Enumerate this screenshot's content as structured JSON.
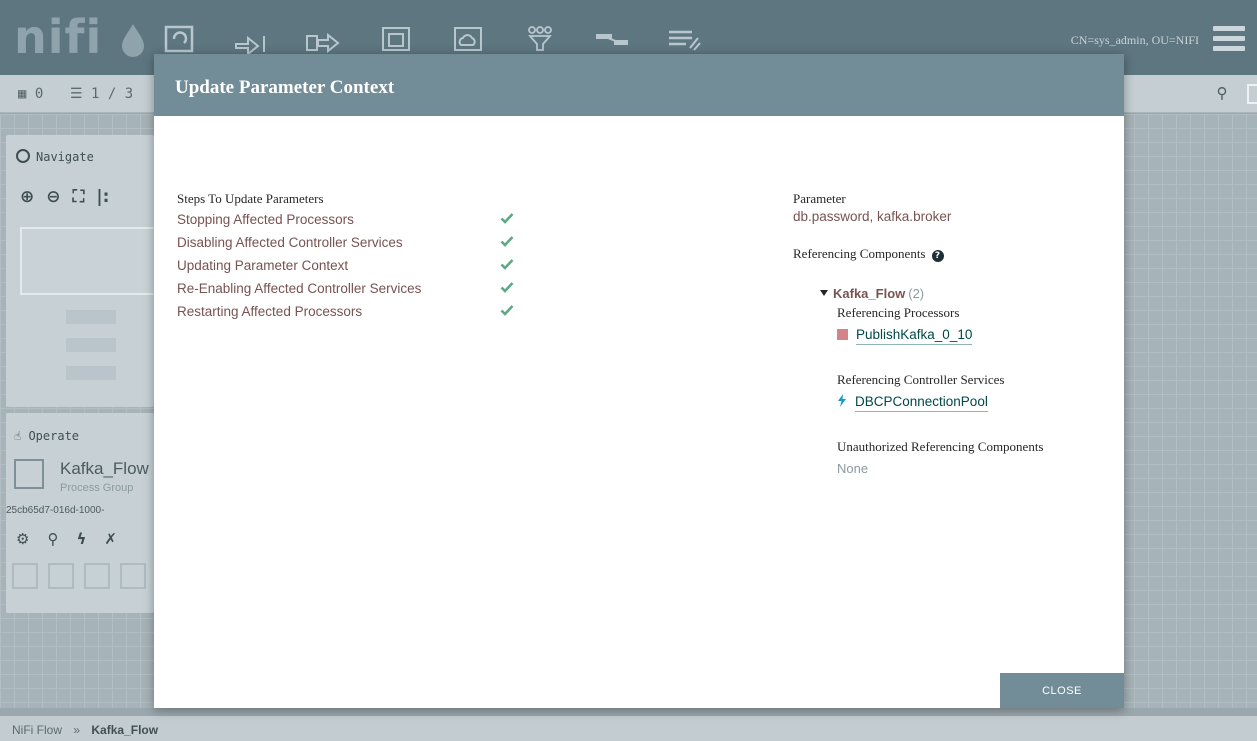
{
  "app": {
    "logo": "nifi",
    "user": "CN=sys_admin, OU=NIFI"
  },
  "toolbar": {
    "icons": [
      "processor-icon",
      "input-port-icon",
      "output-port-icon",
      "process-group-icon",
      "remote-process-group-icon",
      "funnel-icon",
      "template-icon",
      "label-icon"
    ]
  },
  "status": {
    "threads": "0",
    "queued": "1 / 3"
  },
  "navigate": {
    "title": "Navigate"
  },
  "operate": {
    "title": "Operate",
    "component_name": "Kafka_Flow",
    "component_type": "Process Group",
    "component_id": "25cb65d7-016d-1000-"
  },
  "breadcrumb": {
    "root": "NiFi Flow",
    "separator": "»",
    "current": "Kafka_Flow"
  },
  "modal": {
    "title": "Update Parameter Context",
    "steps_label": "Steps To Update Parameters",
    "steps": [
      {
        "label": "Stopping Affected Processors",
        "status": "complete"
      },
      {
        "label": "Disabling Affected Controller Services",
        "status": "complete"
      },
      {
        "label": "Updating Parameter Context",
        "status": "complete"
      },
      {
        "label": "Re-Enabling Affected Controller Services",
        "status": "complete"
      },
      {
        "label": "Restarting Affected Processors",
        "status": "complete"
      }
    ],
    "parameter_label": "Parameter",
    "parameter_value": "db.password, kafka.broker",
    "referencing_label": "Referencing Components",
    "group": {
      "name": "Kafka_Flow",
      "count": "(2)"
    },
    "referencing_processors_label": "Referencing Processors",
    "processor_name": "PublishKafka_0_10",
    "referencing_services_label": "Referencing Controller Services",
    "service_name": "DBCPConnectionPool",
    "unauthorized_label": "Unauthorized Referencing Components",
    "unauthorized_value": "None",
    "close_label": "CLOSE"
  },
  "colors": {
    "header": "#728d98",
    "step_text": "#775351",
    "check": "#5ea987",
    "processor_status": "#d2848a",
    "link": "#004849"
  }
}
